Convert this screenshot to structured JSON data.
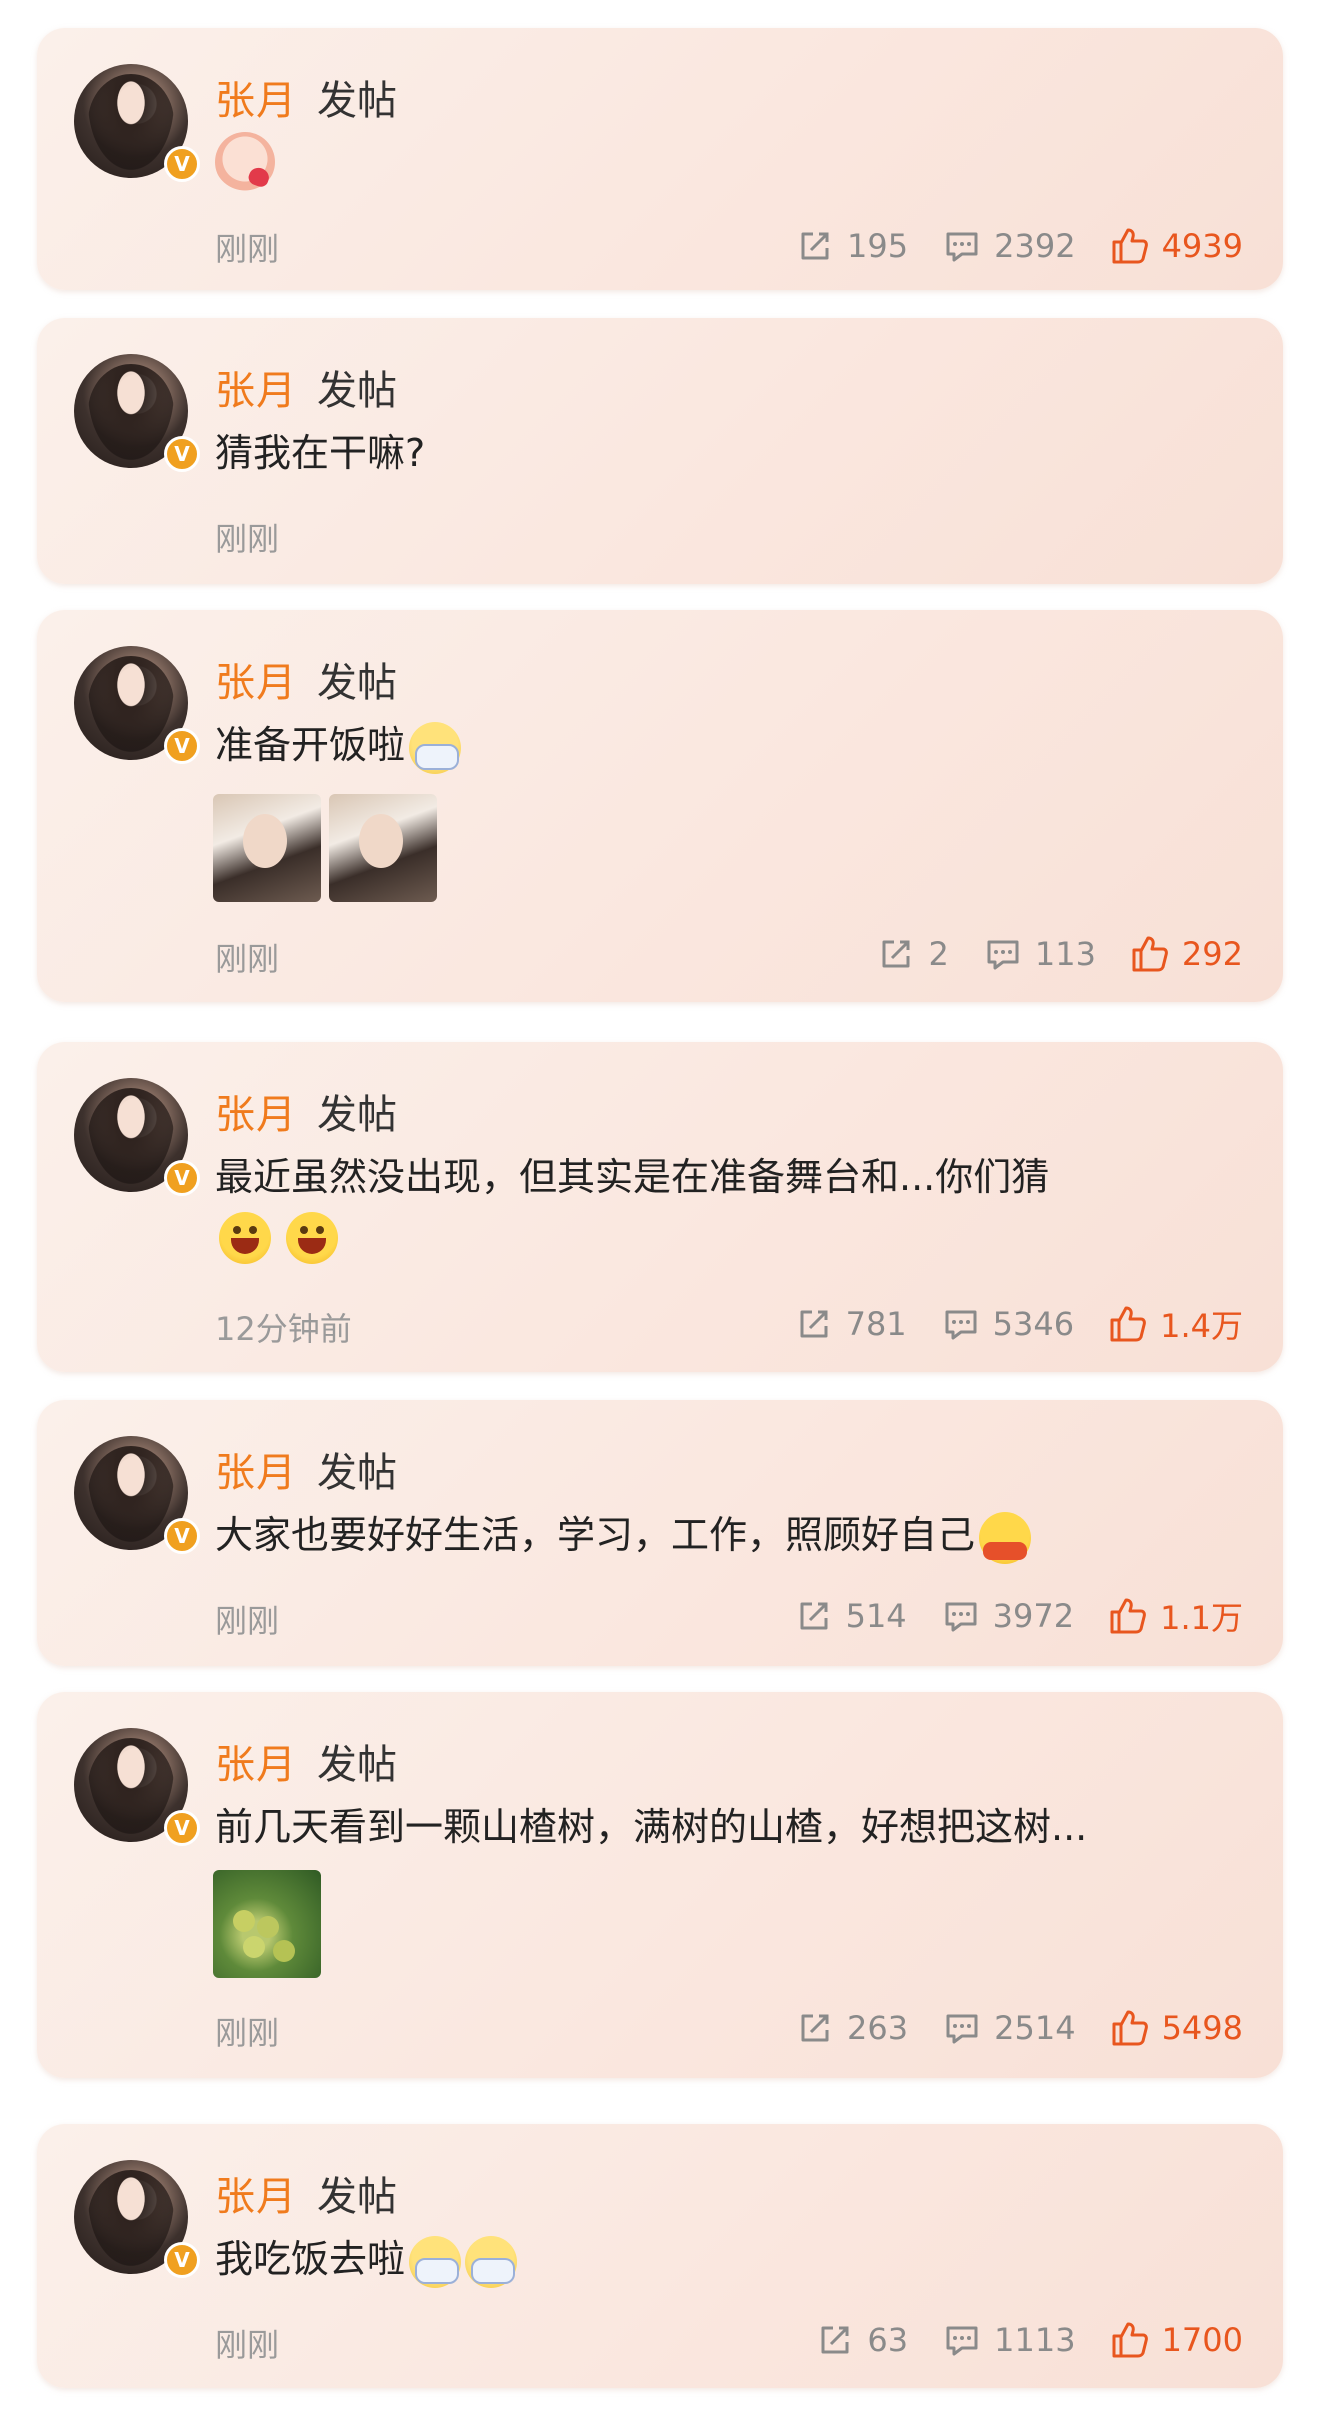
{
  "posts": [
    {
      "name": "张月",
      "action": "发帖",
      "text": "",
      "time": "刚刚",
      "repost": "195",
      "comment": "2392",
      "like": "4939"
    },
    {
      "name": "张月",
      "action": "发帖",
      "text": "猜我在干嘛?",
      "time": "刚刚",
      "repost": "",
      "comment": "",
      "like": ""
    },
    {
      "name": "张月",
      "action": "发帖",
      "text": "准备开饭啦",
      "time": "刚刚",
      "repost": "2",
      "comment": "113",
      "like": "292"
    },
    {
      "name": "张月",
      "action": "发帖",
      "text": "最近虽然没出现，但其实是在准备舞台和...你们猜",
      "time": "12分钟前",
      "repost": "781",
      "comment": "5346",
      "like": "1.4万"
    },
    {
      "name": "张月",
      "action": "发帖",
      "text": "大家也要好好生活，学习，工作，照顾好自己",
      "time": "刚刚",
      "repost": "514",
      "comment": "3972",
      "like": "1.1万"
    },
    {
      "name": "张月",
      "action": "发帖",
      "text": "前几天看到一颗山楂树，满树的山楂，好想把这树...",
      "time": "刚刚",
      "repost": "263",
      "comment": "2514",
      "like": "5498"
    },
    {
      "name": "张月",
      "action": "发帖",
      "text": "我吃饭去啦",
      "time": "刚刚",
      "repost": "63",
      "comment": "1113",
      "like": "1700"
    }
  ],
  "colors": {
    "name": "#f07b1d",
    "like": "#e8561e",
    "muted": "#9a9a9a"
  }
}
